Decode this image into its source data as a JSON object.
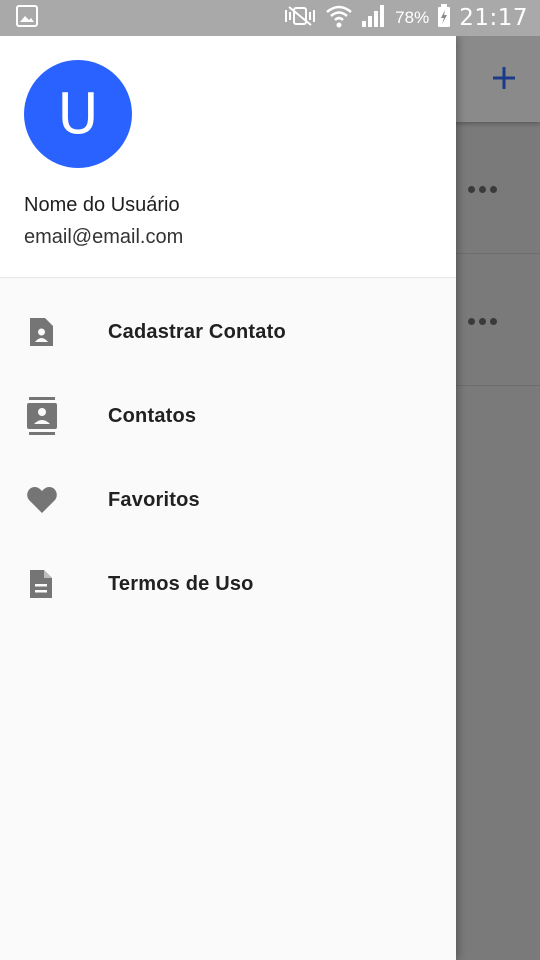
{
  "status_bar": {
    "battery": "78%",
    "time": "21:17",
    "icons": [
      "image-icon",
      "vibrate-icon",
      "wifi-icon",
      "signal-icon",
      "battery-charging-icon"
    ]
  },
  "app_behind": {
    "add_icon": "plus-icon",
    "row_more_icon": "more-horizontal-icon",
    "accent_color": "#1a3a8a"
  },
  "drawer": {
    "avatar_initial": "U",
    "avatar_color": "#2962ff",
    "user_name": "Nome do Usuário",
    "user_email": "email@email.com",
    "items": [
      {
        "label": "Cadastrar Contato",
        "icon": "contact-file-icon"
      },
      {
        "label": "Contatos",
        "icon": "contacts-icon"
      },
      {
        "label": "Favoritos",
        "icon": "heart-icon"
      },
      {
        "label": "Termos de Uso",
        "icon": "document-icon"
      }
    ]
  }
}
